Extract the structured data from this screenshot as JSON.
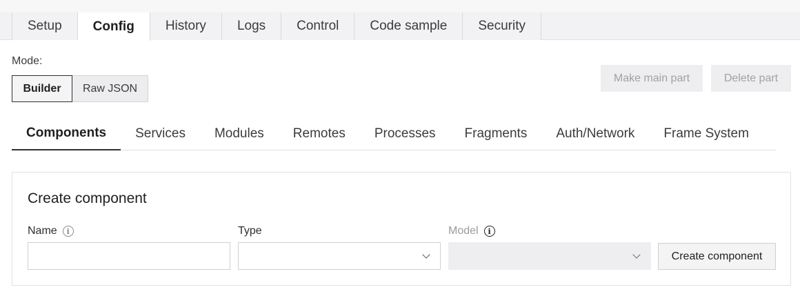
{
  "top_tabs": [
    {
      "label": "Setup",
      "active": false
    },
    {
      "label": "Config",
      "active": true
    },
    {
      "label": "History",
      "active": false
    },
    {
      "label": "Logs",
      "active": false
    },
    {
      "label": "Control",
      "active": false
    },
    {
      "label": "Code sample",
      "active": false
    },
    {
      "label": "Security",
      "active": false
    }
  ],
  "mode": {
    "label": "Mode:",
    "options": [
      "Builder",
      "Raw JSON"
    ],
    "selected": "Builder"
  },
  "actions": {
    "make_main_part": "Make main part",
    "delete_part": "Delete part"
  },
  "sub_tabs": [
    {
      "label": "Components",
      "active": true
    },
    {
      "label": "Services",
      "active": false
    },
    {
      "label": "Modules",
      "active": false
    },
    {
      "label": "Remotes",
      "active": false
    },
    {
      "label": "Processes",
      "active": false
    },
    {
      "label": "Fragments",
      "active": false
    },
    {
      "label": "Auth/Network",
      "active": false
    },
    {
      "label": "Frame System",
      "active": false
    }
  ],
  "create_component": {
    "title": "Create component",
    "name_label": "Name",
    "name_value": "",
    "type_label": "Type",
    "type_value": "",
    "model_label": "Model",
    "model_value": "",
    "button_label": "Create component"
  },
  "icons": {
    "name_info": "info-icon",
    "model_info": "info-icon",
    "select_chevron": "chevron-down-icon"
  }
}
